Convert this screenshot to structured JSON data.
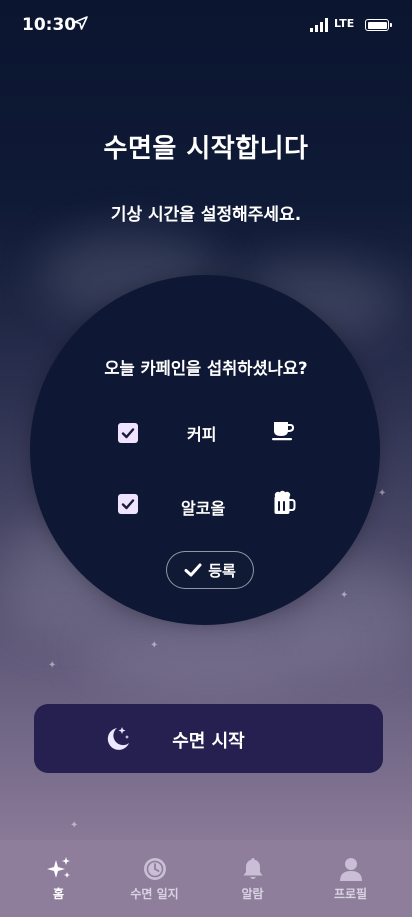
{
  "status_bar": {
    "time": "10:30",
    "network": "LTE"
  },
  "header": {
    "title": "수면을 시작합니다",
    "subtitle": "기상 시간을 설정해주세요."
  },
  "caffeine_card": {
    "question": "오늘 카페인을 섭취하셨나요?",
    "items": [
      {
        "label": "커피",
        "checked": true,
        "icon": "coffee-cup-icon"
      },
      {
        "label": "알코올",
        "checked": true,
        "icon": "beer-mug-icon"
      }
    ],
    "register_label": "등록"
  },
  "start_button": {
    "label": "수면 시작",
    "icon": "moon-stars-icon"
  },
  "tab_bar": {
    "tabs": [
      {
        "label": "홈",
        "icon": "sparkles-icon",
        "active": true
      },
      {
        "label": "수면 일지",
        "icon": "clock-icon",
        "active": false
      },
      {
        "label": "알람",
        "icon": "bell-icon",
        "active": false
      },
      {
        "label": "프로필",
        "icon": "person-icon",
        "active": false
      }
    ]
  },
  "colors": {
    "background_top": "#0b1530",
    "background_bottom": "#8d7d9a",
    "card": "#0e1733",
    "start_button": "#25204f",
    "tab_bar": "#8e7e9b",
    "checkbox": "#efe3ff"
  }
}
